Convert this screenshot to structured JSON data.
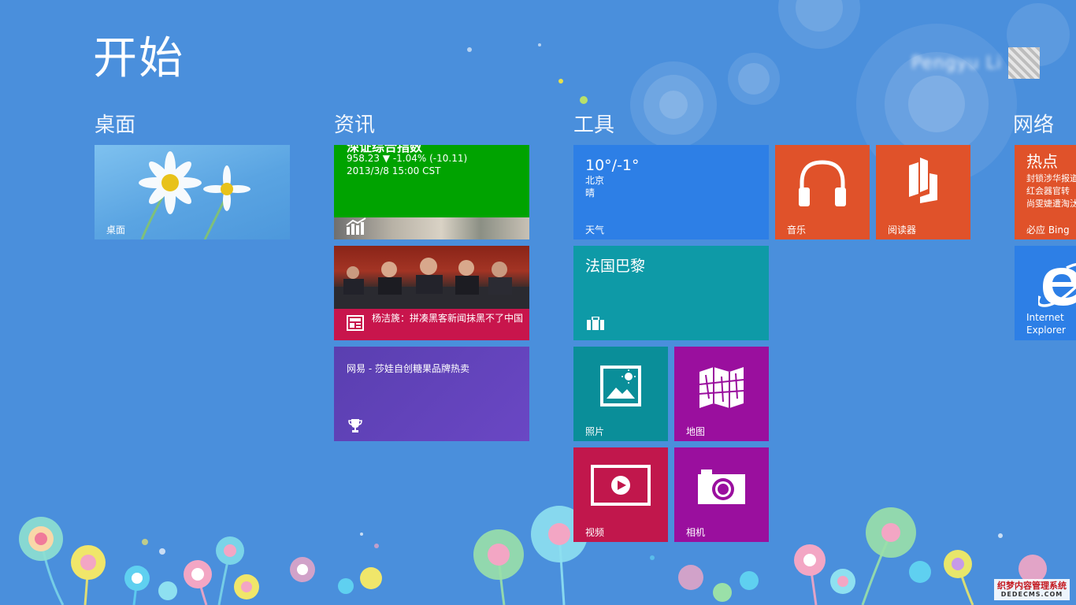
{
  "header": {
    "title": "开始",
    "user_name": "Pengyu Li"
  },
  "groups": {
    "desktop": "桌面",
    "news": "资讯",
    "tools": "工具",
    "network": "网络"
  },
  "tiles": {
    "desktop": {
      "label": "桌面"
    },
    "finance": {
      "title": "深证综合指数",
      "quote": "958.23  ▼ -1.04% (-10.11)",
      "timestamp": "2013/3/8 15:00 CST"
    },
    "news": {
      "headline": "杨洁篪：拼凑黑客新闻抹黑不了中国"
    },
    "game": {
      "text": "网易 - 莎娃自创糖果品牌热卖"
    },
    "weather": {
      "temp": "10°/-1°",
      "city": "北京",
      "condition": "晴",
      "label": "天气"
    },
    "travel": {
      "text": "法国巴黎"
    },
    "music": {
      "label": "音乐"
    },
    "reader": {
      "label": "阅读器"
    },
    "photos": {
      "label": "照片"
    },
    "maps": {
      "label": "地图"
    },
    "video": {
      "label": "视频"
    },
    "camera": {
      "label": "相机"
    },
    "bing": {
      "title": "热点",
      "lines": [
        "封锁涉华报道",
        "红会器官转",
        "尚雯婕遭淘汰"
      ],
      "label": "必应 Bing"
    },
    "ie": {
      "label_line1": "Internet",
      "label_line2": "Explorer"
    }
  },
  "watermark": {
    "line1": "织梦内容管理系统",
    "line2": "DEDECMS.COM"
  },
  "colors": {
    "background": "#4a8fdc",
    "finance": "#00a300",
    "news": "#c8154c",
    "game": "#6a47c4",
    "weather": "#2d7fe6",
    "travel": "#0e9aa7",
    "orange": "#e0522a",
    "teal": "#0a8e99",
    "magenta": "#9a0f9e",
    "crimson": "#c1174c"
  }
}
